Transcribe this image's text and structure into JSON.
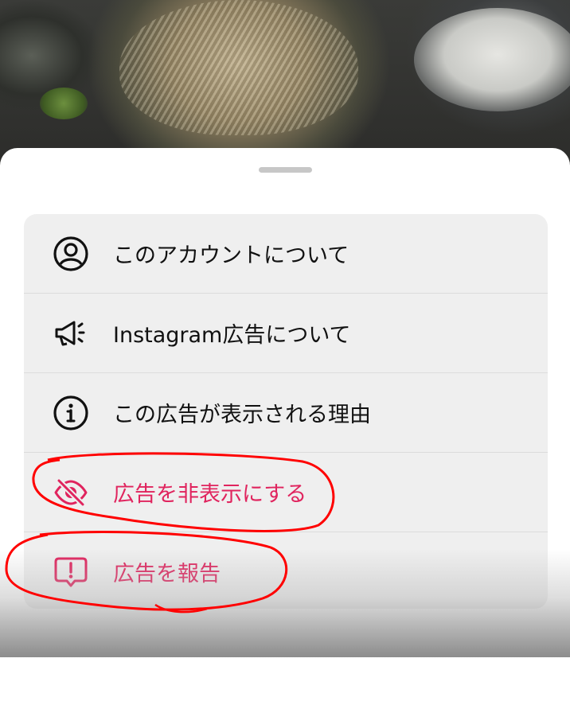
{
  "menu": {
    "items": [
      {
        "label": "このアカウントについて",
        "icon": "account-circle-icon",
        "style": "default"
      },
      {
        "label": "Instagram広告について",
        "icon": "megaphone-icon",
        "style": "default"
      },
      {
        "label": "この広告が表示される理由",
        "icon": "info-icon",
        "style": "default"
      },
      {
        "label": "広告を非表示にする",
        "icon": "eye-off-icon",
        "style": "destructive"
      },
      {
        "label": "広告を報告",
        "icon": "report-icon",
        "style": "destructive"
      }
    ]
  },
  "colors": {
    "destructive": "#e0245e",
    "text": "#111111",
    "menu_background": "#efefef",
    "annotation": "#ff0000"
  }
}
